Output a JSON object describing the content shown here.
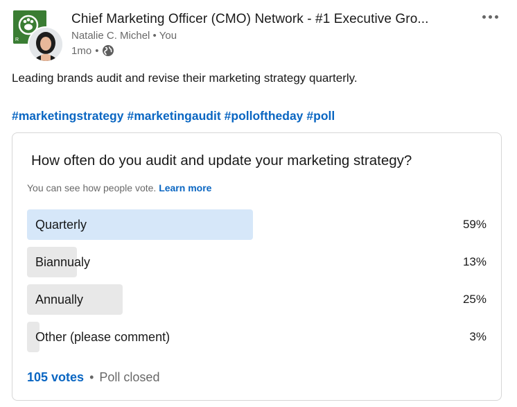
{
  "post": {
    "group_name": "Chief Marketing Officer (CMO) Network - #1 Executive Gro...",
    "author": "Natalie C. Michel",
    "relation": "You",
    "time": "1mo",
    "text": "Leading brands audit and revise their marketing strategy quarterly.",
    "hashtags": [
      "#marketingstrategy",
      "#marketingaudit",
      "#polloftheday",
      "#poll"
    ],
    "icons": {
      "group_logo": "group-logo-icon",
      "globe": "globe-icon",
      "more": "more-options-icon"
    }
  },
  "poll": {
    "question": "How often do you audit and update your marketing strategy?",
    "visibility_text": "You can see how people vote.",
    "learn_more": "Learn more",
    "options": [
      {
        "label": "Quarterly",
        "percent_text": "59%",
        "fraction": 0.59,
        "selected": true
      },
      {
        "label": "Biannualy",
        "percent_text": "13%",
        "fraction": 0.13,
        "selected": false
      },
      {
        "label": "Annually",
        "percent_text": "25%",
        "fraction": 0.25,
        "selected": false
      },
      {
        "label": "Other (please comment)",
        "percent_text": "3%",
        "fraction": 0.03,
        "selected": false
      }
    ],
    "votes": "105 votes",
    "separator": "•",
    "status": "Poll closed"
  },
  "colors": {
    "link_blue": "#0a66c2",
    "selected_bar": "#d6e7f9",
    "bar": "#e8e8e8",
    "group_green": "#3a7d33"
  }
}
